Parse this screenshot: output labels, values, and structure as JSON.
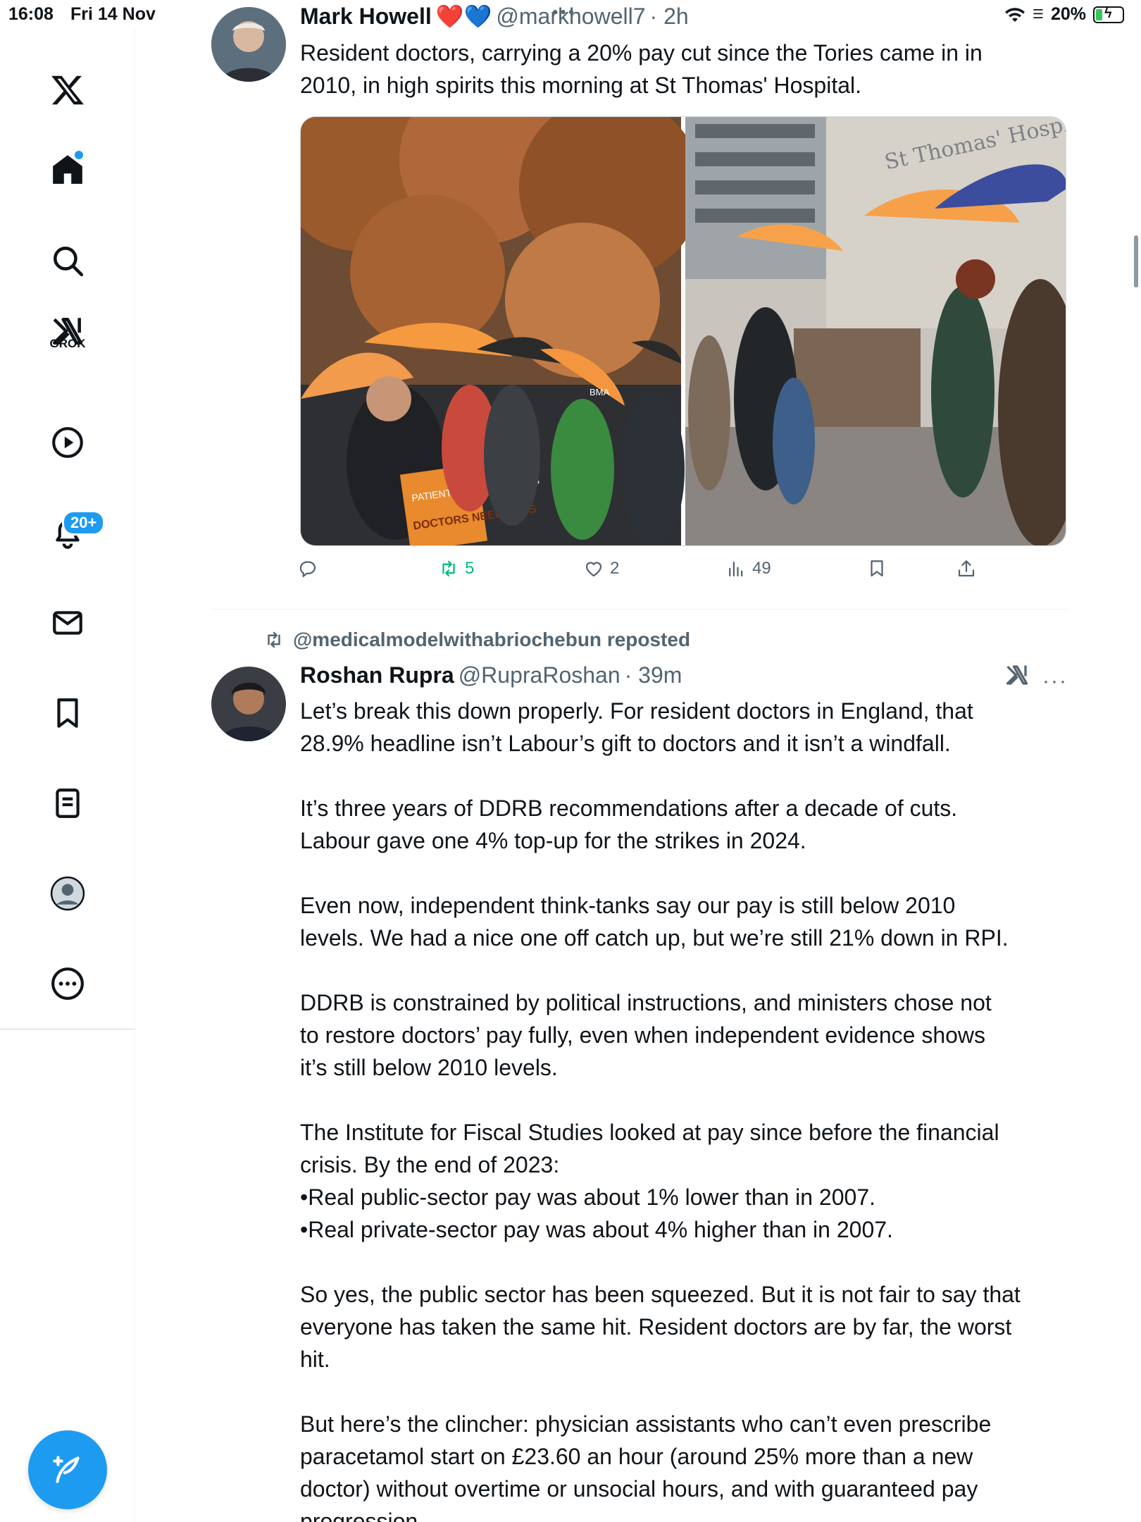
{
  "status_bar": {
    "time": "16:08",
    "date": "Fri 14 Nov",
    "battery": "20%"
  },
  "sidebar": {
    "items": [
      {
        "icon": "x-logo-icon"
      },
      {
        "icon": "home-icon",
        "has_dot": true
      },
      {
        "icon": "search-icon"
      },
      {
        "icon": "grok-icon",
        "label": "GROK"
      },
      {
        "icon": "play-icon"
      },
      {
        "icon": "bell-icon",
        "badge": "20+"
      },
      {
        "icon": "mail-icon"
      },
      {
        "icon": "bookmark-icon"
      },
      {
        "icon": "list-icon"
      },
      {
        "icon": "profile-icon"
      },
      {
        "icon": "more-icon"
      }
    ],
    "compose_icon": "compose-icon"
  },
  "tweet1": {
    "name": "Mark Howell",
    "emoji": "❤️💙",
    "handle": "@markhowell7",
    "time": "· 2h",
    "text": "Resident doctors, carrying a 20% pay cut since the Tories came in in\n2010, in high spirits this morning at St Thomas' Hospital.",
    "photo_sign_1": "PATIENTS NEED DOCTORS",
    "photo_sign_2": "DOCTORS NEED JOBS",
    "photo_brand": "BMA",
    "building_sign": "St Thomas' Hospital",
    "actions": {
      "replies": "",
      "reposts": "5",
      "likes": "2",
      "views": "49"
    }
  },
  "tweet2": {
    "reposted_by": "@medicalmodelwithabriochebun reposted",
    "name": "Roshan Rupra",
    "handle": "@RupraRoshan",
    "time": "· 39m",
    "text": "Let’s break this down properly. For resident doctors in England, that\n28.9% headline isn’t Labour’s gift to doctors and it isn’t a windfall.\n\nIt’s three years of DDRB recommendations after a decade of cuts.\nLabour gave one 4% top-up for the strikes in 2024.\n\nEven now, independent think-tanks say our pay is still below 2010\nlevels. We had a nice one off catch up, but we’re still 21% down in RPI.\n\nDDRB is constrained by political instructions, and ministers chose not\nto restore doctors’ pay fully, even when independent evidence shows\nit’s still below 2010 levels.\n\nThe Institute for Fiscal Studies looked at pay since before the financial\ncrisis. By the end of 2023:\n•Real public-sector pay was about 1% lower than in 2007.\n•Real private-sector pay was about 4% higher than in 2007.\n\nSo yes, the public sector has been squeezed. But it is not fair to say that\neveryone has taken the same hit. Resident doctors are by far, the worst\nhit.\n\nBut here’s the clincher: physician assistants who can’t even prescribe\nparacetamol start on £23.60 an hour (around 25% more than a new\ndoctor) without overtime or unsocial hours, and with guaranteed pay\nprogression"
  },
  "colors": {
    "accent": "#1d9bf0",
    "repost_green": "#00ba7c",
    "secondary_text": "#536471"
  }
}
